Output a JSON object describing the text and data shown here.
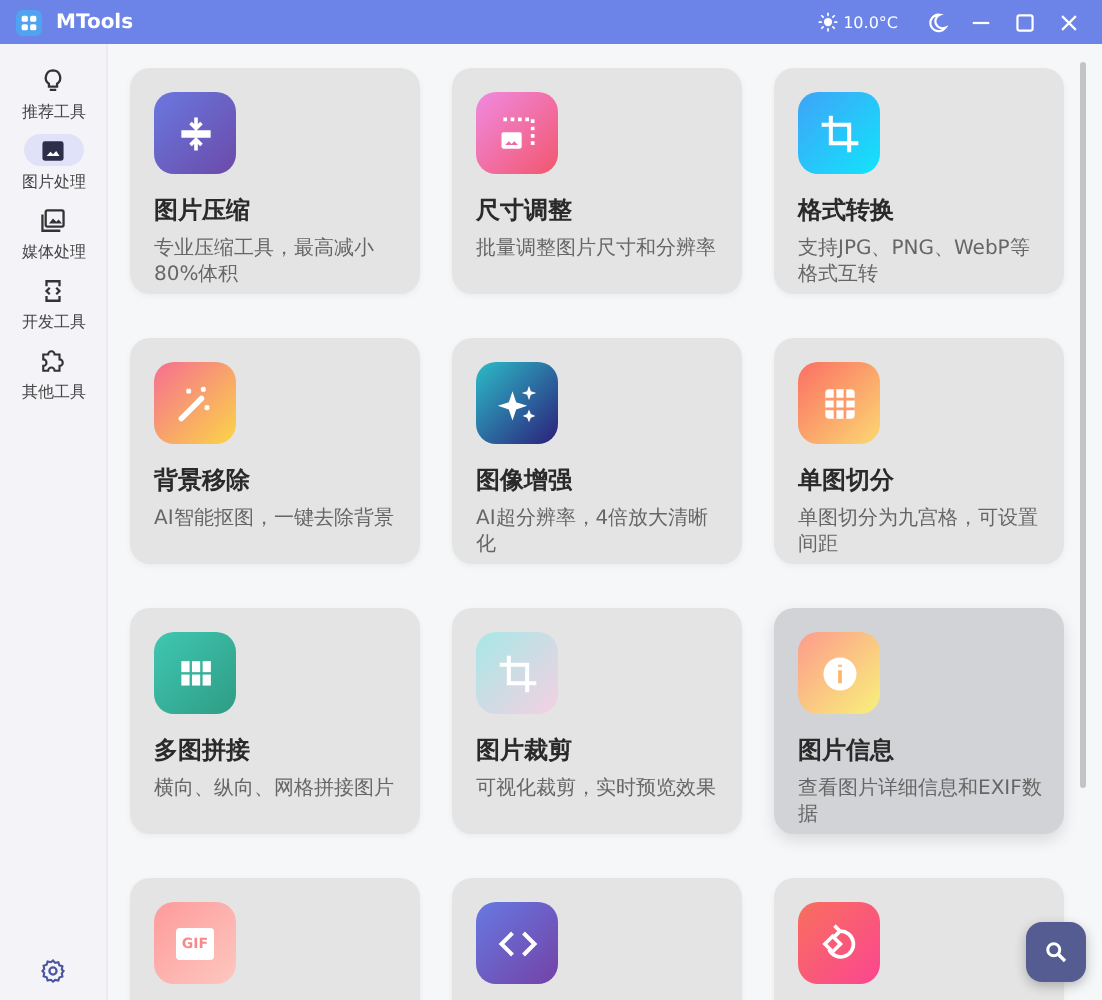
{
  "window": {
    "title": "MTools",
    "weather": "10.0°C"
  },
  "sidebar": {
    "items": [
      {
        "label": "推荐工具",
        "kind": "bulb",
        "selected": false
      },
      {
        "label": "图片处理",
        "kind": "image",
        "selected": true
      },
      {
        "label": "媒体处理",
        "kind": "media",
        "selected": false
      },
      {
        "label": "开发工具",
        "kind": "code",
        "selected": false
      },
      {
        "label": "其他工具",
        "kind": "puzzle",
        "selected": false
      }
    ]
  },
  "tools": [
    {
      "kind": "compress",
      "title": "图片压缩",
      "description": "专业压缩工具，最高减小80%体积",
      "highlighted": false
    },
    {
      "kind": "resize",
      "title": "尺寸调整",
      "description": "批量调整图片尺寸和分辨率",
      "highlighted": false
    },
    {
      "kind": "convert",
      "title": "格式转换",
      "description": "支持JPG、PNG、WebP等格式互转",
      "highlighted": false
    },
    {
      "kind": "wand",
      "title": "背景移除",
      "description": "AI智能抠图，一键去除背景",
      "highlighted": false
    },
    {
      "kind": "sparkle",
      "title": "图像增强",
      "description": "AI超分辨率，4倍放大清晰化",
      "highlighted": false
    },
    {
      "kind": "grid",
      "title": "单图切分",
      "description": "单图切分为九宫格，可设置间距",
      "highlighted": false
    },
    {
      "kind": "tiles",
      "title": "多图拼接",
      "description": "横向、纵向、网格拼接图片",
      "highlighted": false
    },
    {
      "kind": "crop",
      "title": "图片裁剪",
      "description": "可视化裁剪，实时预览效果",
      "highlighted": false
    },
    {
      "kind": "info",
      "title": "图片信息",
      "description": "查看图片详细信息和EXIF数据",
      "highlighted": true
    },
    {
      "kind": "gif",
      "badge": "GIF",
      "highlighted": false
    },
    {
      "kind": "codeicon",
      "highlighted": false
    },
    {
      "kind": "rotate",
      "highlighted": false
    }
  ]
}
